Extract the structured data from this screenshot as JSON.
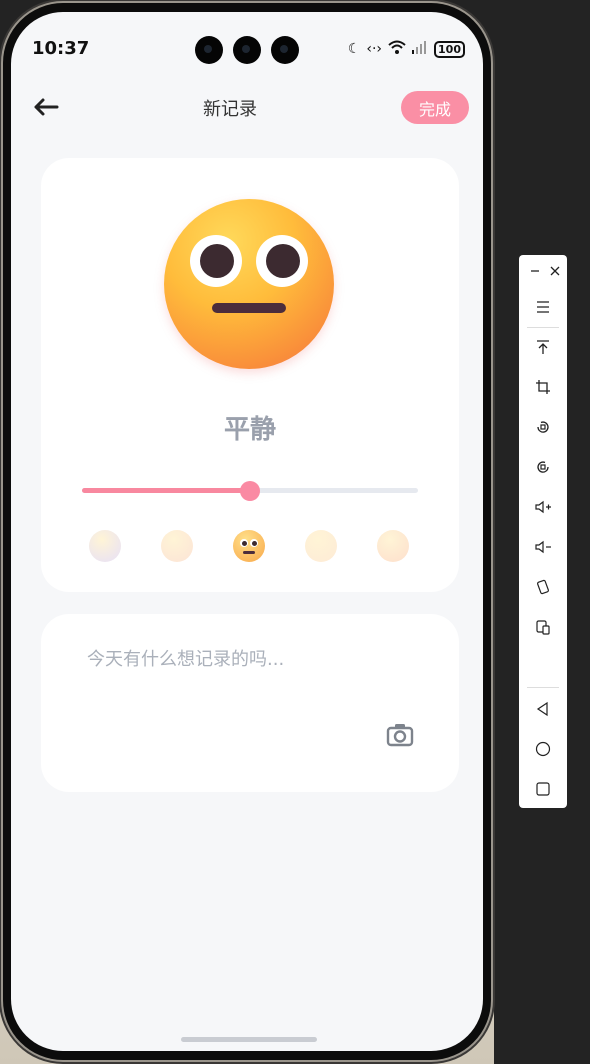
{
  "status": {
    "time": "10:37",
    "battery": "100"
  },
  "header": {
    "title": "新记录",
    "done_label": "完成"
  },
  "mood": {
    "selected_label": "平静",
    "slider_fraction": 0.5,
    "selected_index": 2
  },
  "mood_faces": [
    {
      "icon": "crying-face-icon",
      "color": "#b9a6e8"
    },
    {
      "icon": "tired-face-icon",
      "color": "#f6b08a"
    },
    {
      "icon": "neutral-face-icon",
      "color": "#f9a84a"
    },
    {
      "icon": "smiling-face-icon",
      "color": "#fcc58a"
    },
    {
      "icon": "heart-eyes-face-icon",
      "color": "#f9a36e"
    }
  ],
  "note": {
    "placeholder": "今天有什么想记录的吗..."
  },
  "colors": {
    "accent": "#fa8fa5",
    "track": "#e6e9ef",
    "background": "#f6f7f9"
  }
}
